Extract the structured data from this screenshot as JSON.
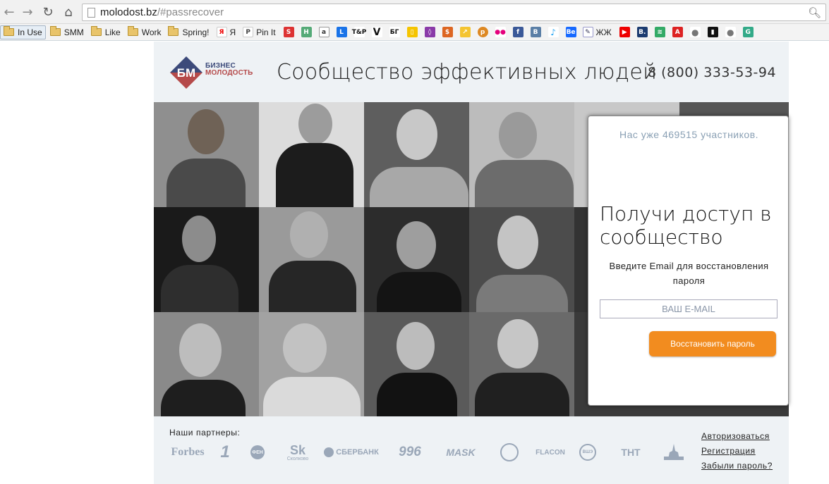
{
  "browser": {
    "url_host": "molodost.bz",
    "url_path": "/#passrecover",
    "bookmarks": [
      {
        "label": "In Use",
        "type": "folder"
      },
      {
        "label": "SMM",
        "type": "folder"
      },
      {
        "label": "Like",
        "type": "folder"
      },
      {
        "label": "Work",
        "type": "folder"
      },
      {
        "label": "Spring!",
        "type": "folder"
      },
      {
        "label": "Я",
        "type": "site"
      },
      {
        "label": "Pin It",
        "type": "site"
      },
      {
        "label": "ЖЖ",
        "type": "site"
      }
    ]
  },
  "header": {
    "logo_line1": "БИЗНЕС",
    "logo_line2": "МОЛОДОСТЬ",
    "logo_mark": "БМ",
    "tagline": "Сообщество эффективных людей",
    "phone": "8 (800) 333-53-94"
  },
  "signup": {
    "count_text": "Нас уже 469515 участников.",
    "heading": "Получи доступ в сообщество",
    "hint": "Введите Email для восстановления пароля",
    "email_placeholder": "ВАШ E-MAIL",
    "submit_label": "Восстановить пароль"
  },
  "footer": {
    "partners_label": "Наши партнеры:",
    "partners": [
      "Forbes",
      "1",
      "ФЕН",
      "Sk",
      "СБЕРБАНК",
      "996",
      "MASK",
      "seal",
      "FLACON",
      "ВШЭ",
      "ТНТ",
      "МГУ"
    ],
    "partner_sub_sk": "Сколково",
    "links": [
      "Авторизоваться",
      "Регистрация",
      "Забыли пароль?"
    ]
  },
  "colors": {
    "accent": "#f28c1f",
    "header_bg": "#eef2f5",
    "logo_blue": "#3c4a7a",
    "logo_red": "#b54a4a"
  }
}
